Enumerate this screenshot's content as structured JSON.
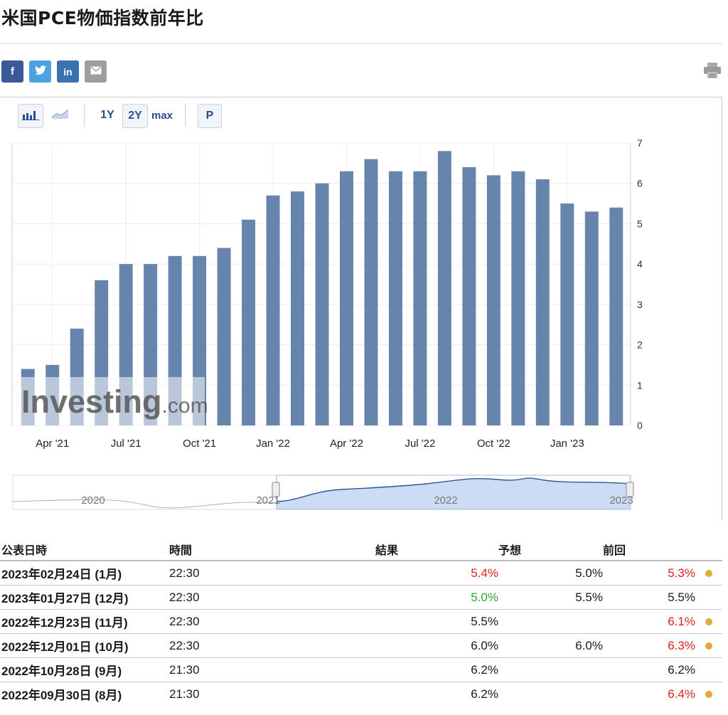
{
  "page": {
    "title": "米国PCE物価指数前年比"
  },
  "share": {
    "facebook": {
      "glyph": "f",
      "color": "#3b5998"
    },
    "twitter": {
      "glyph": "t",
      "color": "#4aa3df"
    },
    "linkedin": {
      "glyph": "in",
      "color": "#3a72b0"
    },
    "email": {
      "glyph": "✉",
      "color": "#9e9e9e"
    },
    "print": "printer-icon"
  },
  "toolbar": {
    "range_1y": "1Y",
    "range_2y": "2Y",
    "range_max": "max",
    "p_label": "P"
  },
  "chart_data": {
    "type": "bar",
    "categories": [
      "2021-02",
      "2021-03",
      "2021-04",
      "2021-05",
      "2021-06",
      "2021-07",
      "2021-08",
      "2021-09",
      "2021-10",
      "2021-11",
      "2021-12",
      "2022-01",
      "2022-02",
      "2022-03",
      "2022-04",
      "2022-05",
      "2022-06",
      "2022-07",
      "2022-08",
      "2022-09",
      "2022-10",
      "2022-11",
      "2022-12",
      "2023-01"
    ],
    "values": [
      1.4,
      1.5,
      2.4,
      3.6,
      4.0,
      4.0,
      4.2,
      4.2,
      4.4,
      5.1,
      5.7,
      5.8,
      6.0,
      6.3,
      6.6,
      6.3,
      6.3,
      6.8,
      6.4,
      6.2,
      6.3,
      6.1,
      5.5,
      5.3,
      5.4
    ],
    "xtick_labels": [
      "Apr '21",
      "Jul '21",
      "Oct '21",
      "Jan '22",
      "Apr '22",
      "Jul '22",
      "Oct '22",
      "Jan '23"
    ],
    "ytick_labels": [
      "0",
      "1",
      "2",
      "3",
      "4",
      "5",
      "6",
      "7"
    ],
    "ylim": [
      0,
      7
    ],
    "grid": true,
    "bar_color": "#6784ad",
    "watermark": "Investing.com",
    "navigator": {
      "year_labels": [
        "2020",
        "2021",
        "2022",
        "2023"
      ]
    }
  },
  "table": {
    "headers": {
      "date": "公表日時",
      "time": "時間",
      "actual": "結果",
      "forecast": "予想",
      "previous": "前回"
    },
    "rows": [
      {
        "date": "2023年02月24日 (1月)",
        "time": "22:30",
        "actual": "5.4%",
        "actual_color": "red",
        "forecast": "5.0%",
        "previous": "5.3%",
        "previous_color": "red",
        "revised": true
      },
      {
        "date": "2023年01月27日 (12月)",
        "time": "22:30",
        "actual": "5.0%",
        "actual_color": "green",
        "forecast": "5.5%",
        "previous": "5.5%",
        "previous_color": "",
        "revised": false
      },
      {
        "date": "2022年12月23日 (11月)",
        "time": "22:30",
        "actual": "5.5%",
        "actual_color": "",
        "forecast": "",
        "previous": "6.1%",
        "previous_color": "red",
        "revised": true
      },
      {
        "date": "2022年12月01日 (10月)",
        "time": "22:30",
        "actual": "6.0%",
        "actual_color": "",
        "forecast": "6.0%",
        "previous": "6.3%",
        "previous_color": "red",
        "revised": true
      },
      {
        "date": "2022年10月28日 (9月)",
        "time": "21:30",
        "actual": "6.2%",
        "actual_color": "",
        "forecast": "",
        "previous": "6.2%",
        "previous_color": "",
        "revised": false
      },
      {
        "date": "2022年09月30日 (8月)",
        "time": "21:30",
        "actual": "6.2%",
        "actual_color": "",
        "forecast": "",
        "previous": "6.4%",
        "previous_color": "red",
        "revised": true
      }
    ]
  }
}
